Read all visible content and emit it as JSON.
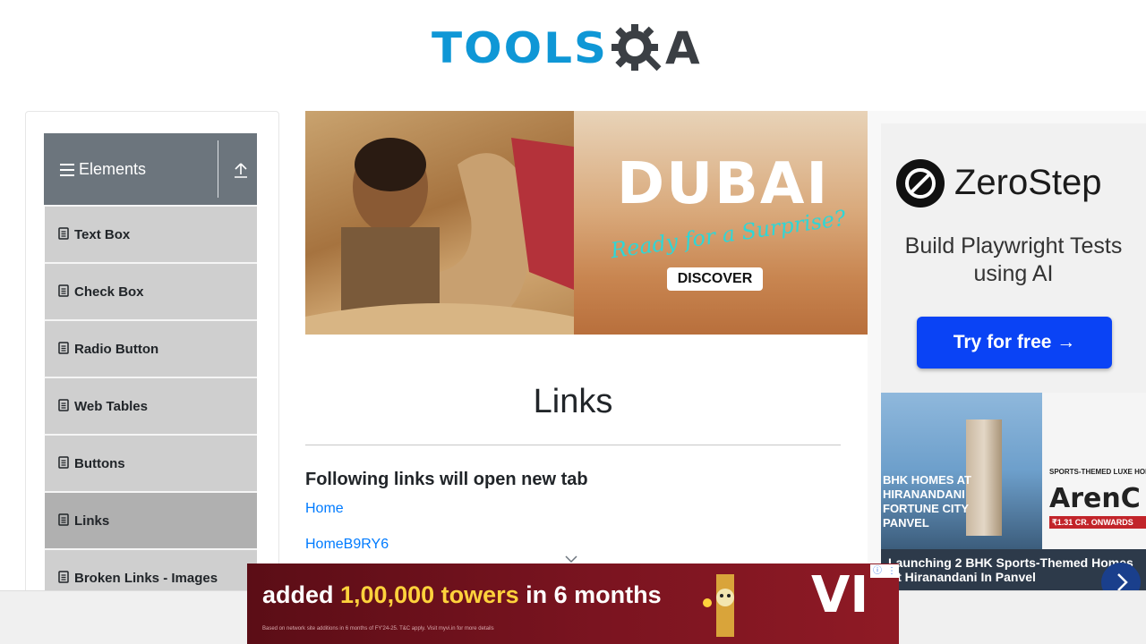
{
  "header": {
    "logo_tools": "TOOLS",
    "logo_a": "A"
  },
  "sidebar": {
    "group_title": "Elements",
    "items": [
      {
        "label": "Text Box"
      },
      {
        "label": "Check Box"
      },
      {
        "label": "Radio Button"
      },
      {
        "label": "Web Tables"
      },
      {
        "label": "Buttons"
      },
      {
        "label": "Links",
        "active": true
      },
      {
        "label": "Broken Links - Images"
      }
    ]
  },
  "ads": {
    "dubai": {
      "headline": "DUBAI",
      "tagline": "Ready for a Surprise?",
      "button": "DISCOVER"
    },
    "zerostep": {
      "brand": "ZeroStep",
      "subtitle": "Build Playwright Tests using AI",
      "button": "Try for free →"
    },
    "hiranandani": {
      "left_label": "BHK HOMES AT HIRANANDANI FORTUNE CITY PANVEL",
      "right_sub": "SPORTS-THEMED LUXE HOMES",
      "arena": "ArenC",
      "price": "₹1.31 CR. ONWARDS",
      "caption": "Launching 2 BHK Sports-Themed Homes At Hiranandani In Panvel"
    },
    "bottom": {
      "text_pre": "added ",
      "text_highlight": "1,00,000 towers",
      "text_post": " in 6 months",
      "brand": "VI",
      "fine_print": "Based on network site additions in 6 months of FY'24-25. T&C apply. Visit myvi.in for more details"
    }
  },
  "main": {
    "title": "Links",
    "section_heading": "Following links will open new tab",
    "links": [
      {
        "text": "Home"
      },
      {
        "text": "HomeB9RY6"
      }
    ]
  },
  "colors": {
    "accent": "#007bff",
    "sidebar_header": "#6c757d",
    "menu_item": "#cfcfcf",
    "menu_item_active": "#b0b0b0",
    "logo_blue": "#0f97d6"
  }
}
